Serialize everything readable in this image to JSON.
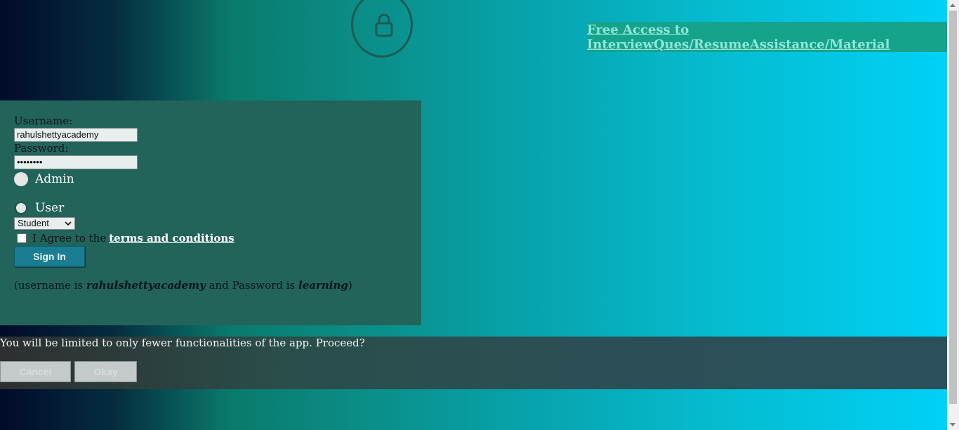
{
  "promo": {
    "link_text": "Free Access to InterviewQues/ResumeAssistance/Material"
  },
  "login": {
    "username_label": "Username:",
    "username_value": "rahulshettyacademy",
    "password_label": "Password:",
    "password_value": "••••••••",
    "radio_admin": "Admin",
    "radio_user": "User",
    "selected_radio": "User",
    "role_select": "Student",
    "agree_text": "I Agree to the",
    "terms_link": "terms and conditions",
    "signin_label": "Sign In",
    "hint_prefix": "(username is",
    "hint_username": "rahulshettyacademy",
    "hint_middle": "and Password is",
    "hint_password": "learning",
    "hint_suffix": ")"
  },
  "modal": {
    "message": "You will be limited to only fewer functionalities of the app. Proceed?",
    "cancel_label": "Cancel",
    "okay_label": "Okay"
  },
  "icons": {
    "lock": "lock-icon",
    "select_arrow": "chevron-down-icon"
  }
}
